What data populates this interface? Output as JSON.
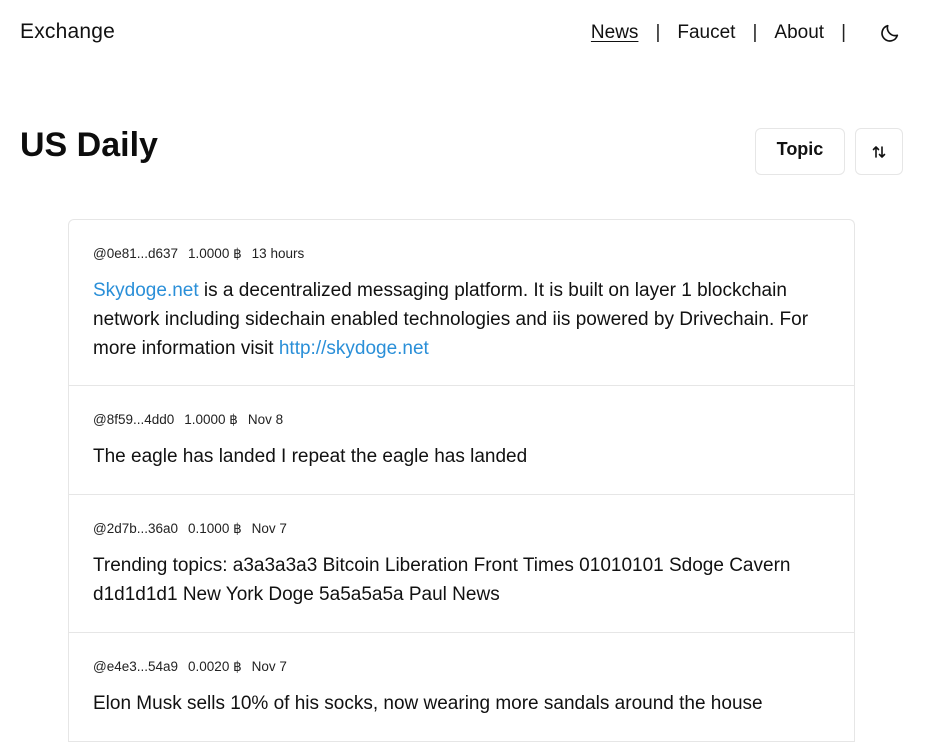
{
  "header": {
    "brand": "Exchange",
    "nav": [
      {
        "label": "News"
      },
      {
        "label": "Faucet"
      },
      {
        "label": "About"
      }
    ],
    "separator": "|",
    "theme_icon": "moon-icon"
  },
  "page": {
    "title": "US Daily",
    "topic_button": "Topic",
    "sort_icon": "sort-arrows-icon"
  },
  "colors": {
    "link": "#2a8fd8",
    "border": "#e6e6e6"
  },
  "posts": [
    {
      "author": "@0e81...d637",
      "amount": "1.0000 ฿",
      "time": "13 hours",
      "link_start": "Skydoge.net",
      "text": " is a decentralized messaging platform. It is built on layer 1 blockchain network including sidechain enabled technologies and iis powered by Drivechain. For more information visit ",
      "link_end": "http://skydoge.net"
    },
    {
      "author": "@8f59...4dd0",
      "amount": "1.0000 ฿",
      "time": "Nov 8",
      "text": "The eagle has landed I repeat the eagle has landed"
    },
    {
      "author": "@2d7b...36a0",
      "amount": "0.1000 ฿",
      "time": "Nov 7",
      "text": "Trending topics: a3a3a3a3 Bitcoin Liberation Front Times 01010101 Sdoge Cavern d1d1d1d1 New York Doge 5a5a5a5a Paul News"
    },
    {
      "author": "@e4e3...54a9",
      "amount": "0.0020 ฿",
      "time": "Nov 7",
      "text": "Elon Musk sells 10% of his socks, now wearing more sandals around the house"
    }
  ]
}
